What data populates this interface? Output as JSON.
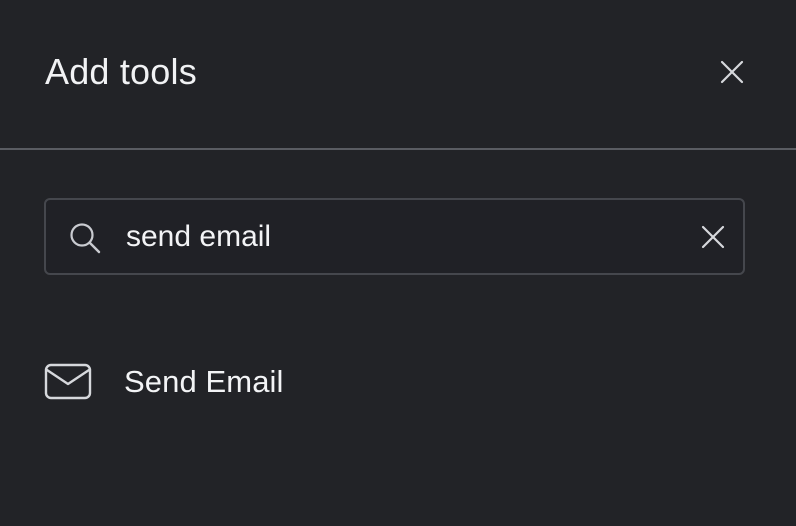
{
  "dialog": {
    "title": "Add tools",
    "close_icon": "close-icon"
  },
  "search": {
    "value": "send email",
    "placeholder": "",
    "search_icon": "search-icon",
    "clear_icon": "clear-icon"
  },
  "results": [
    {
      "label": "Send Email",
      "icon": "mail-icon"
    }
  ],
  "colors": {
    "background": "#222327",
    "text": "#f1f2f4",
    "border": "#45474d",
    "divider": "#5a5c62",
    "icon": "#d6d8dc"
  }
}
